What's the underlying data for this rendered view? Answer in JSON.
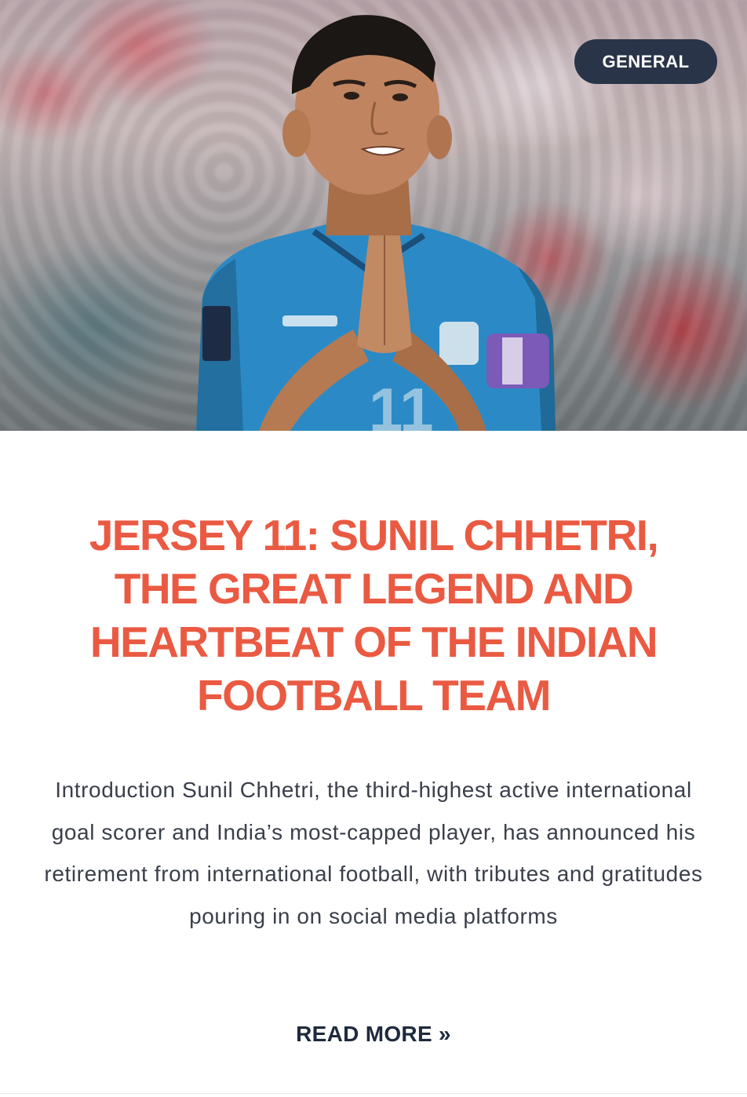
{
  "card": {
    "image_alt": "Sunil Chhetri with folded hands looking up",
    "category_badge": "GENERAL",
    "title": "JERSEY 11: SUNIL CHHETRI, THE GREAT LEGEND AND HEARTBEAT OF THE INDIAN FOOTBALL TEAM",
    "excerpt": "Introduction  Sunil Chhetri, the third-highest active international goal scorer and India’s most-capped player, has announced his retirement from international football, with tributes and gratitudes pouring in on social media platforms",
    "read_more": "READ MORE »"
  },
  "colors": {
    "title": "#ea5a42",
    "badge_bg": "#2a3448",
    "read_more": "#1f2a3c",
    "jersey": "#2b8ac6"
  }
}
